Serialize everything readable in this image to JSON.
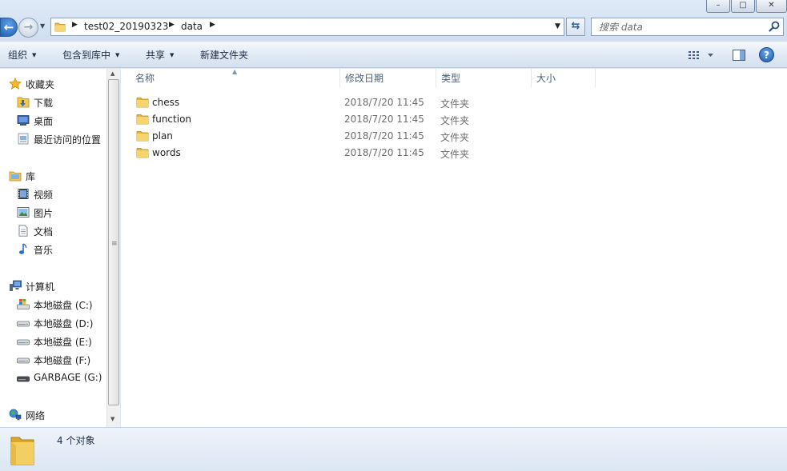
{
  "window": {
    "minimize_icon": "minimize-icon",
    "maximize_icon": "maximize-icon",
    "close_icon": "close-icon"
  },
  "address": {
    "breadcrumbs": [
      "test02_20190323",
      "data"
    ],
    "folder_icon": "folder-icon"
  },
  "search": {
    "placeholder": "搜索 data",
    "icon": "search-icon"
  },
  "toolbar": {
    "organize": "组织",
    "include_in_library": "包含到库中",
    "share": "共享",
    "new_folder": "新建文件夹",
    "view_icon": "view-options-icon",
    "preview_icon": "preview-pane-icon",
    "help_label": "?"
  },
  "nav": {
    "favorites": {
      "label": "收藏夹",
      "icon": "star-icon"
    },
    "favorites_items": [
      {
        "label": "下载",
        "icon": "downloads-icon"
      },
      {
        "label": "桌面",
        "icon": "desktop-icon"
      },
      {
        "label": "最近访问的位置",
        "icon": "recent-places-icon"
      }
    ],
    "libraries": {
      "label": "库",
      "icon": "library-icon"
    },
    "library_items": [
      {
        "label": "视频",
        "icon": "video-icon"
      },
      {
        "label": "图片",
        "icon": "pictures-icon"
      },
      {
        "label": "文档",
        "icon": "documents-icon"
      },
      {
        "label": "音乐",
        "icon": "music-icon"
      }
    ],
    "computer": {
      "label": "计算机",
      "icon": "computer-icon"
    },
    "computer_items": [
      {
        "label": "本地磁盘 (C:)",
        "icon": "system-drive-icon"
      },
      {
        "label": "本地磁盘 (D:)",
        "icon": "drive-icon"
      },
      {
        "label": "本地磁盘 (E:)",
        "icon": "drive-icon"
      },
      {
        "label": "本地磁盘 (F:)",
        "icon": "drive-icon"
      },
      {
        "label": "GARBAGE (G:)",
        "icon": "removable-drive-icon"
      }
    ],
    "network": {
      "label": "网络",
      "icon": "network-icon"
    }
  },
  "columns": {
    "name": "名称",
    "date": "修改日期",
    "type": "类型",
    "size": "大小"
  },
  "files": [
    {
      "name": "chess",
      "date": "2018/7/20 11:45",
      "type": "文件夹"
    },
    {
      "name": "function",
      "date": "2018/7/20 11:45",
      "type": "文件夹"
    },
    {
      "name": "plan",
      "date": "2018/7/20 11:45",
      "type": "文件夹"
    },
    {
      "name": "words",
      "date": "2018/7/20 11:45",
      "type": "文件夹"
    }
  ],
  "status": {
    "item_count": "4 个对象"
  },
  "colors": {
    "folder": "#f2c94c",
    "accent": "#1f5fb0",
    "selection": "#cce8ff"
  }
}
